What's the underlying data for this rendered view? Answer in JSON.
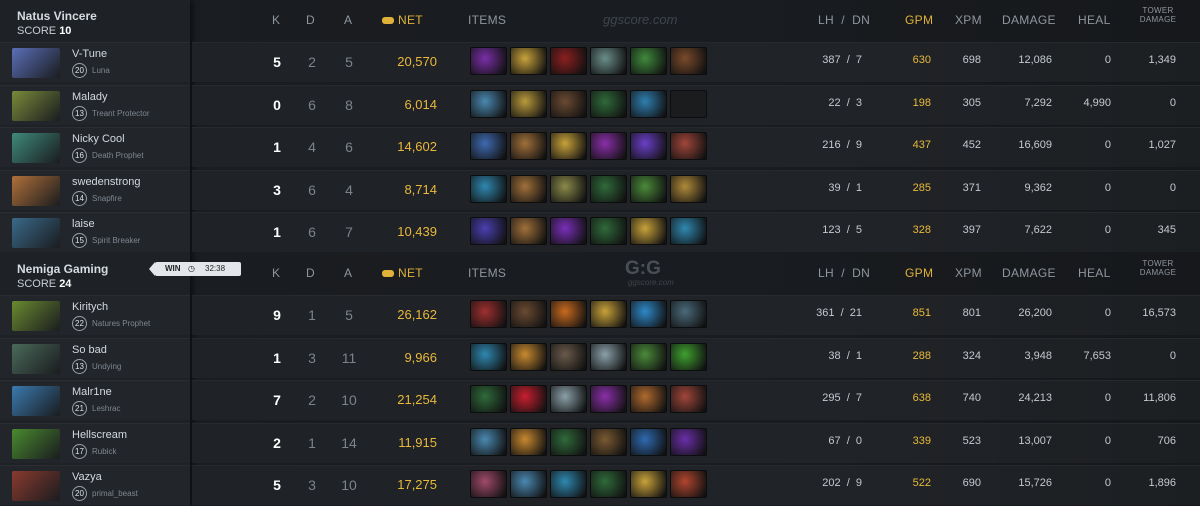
{
  "headers": {
    "k": "K",
    "d": "D",
    "a": "A",
    "net": "NET",
    "items": "ITEMS",
    "lhdn": "LH  /  DN",
    "gpm": "GPM",
    "xpm": "XPM",
    "damage": "DAMAGE",
    "heal": "HEAL",
    "tower": "TOWER DAMAGE"
  },
  "watermark": {
    "top": "ggscore.com",
    "logo": "G:G",
    "logo_sub": "ggscore.com"
  },
  "teams": [
    {
      "name": "Natus Vincere",
      "score_label": "SCORE",
      "score": "10",
      "players": [
        {
          "name": "V-Tune",
          "level": "20",
          "hero": "Luna",
          "k": "5",
          "d": "2",
          "a": "5",
          "net": "20,570",
          "lhdn": "387  /  7",
          "gpm": "630",
          "xpm": "698",
          "damage": "12,086",
          "heal": "0",
          "tower": "1,349",
          "portrait_color": "#5b6fb8",
          "items": [
            "#7a2fa8",
            "#c8a23a",
            "#8b1f1f",
            "#6a8e8a",
            "#3f8a3c",
            "#7a4a2a"
          ]
        },
        {
          "name": "Malady",
          "level": "13",
          "hero": "Treant Protector",
          "k": "0",
          "d": "6",
          "a": "8",
          "net": "6,014",
          "lhdn": "22  /  3",
          "gpm": "198",
          "xpm": "305",
          "damage": "7,292",
          "heal": "4,990",
          "tower": "0",
          "portrait_color": "#7a8a3a",
          "items": [
            "#4a88b0",
            "#b99a3c",
            "#6a4a32",
            "#2f6a3a",
            "#2f7fb0",
            "#1a1c1e"
          ]
        },
        {
          "name": "Nicky Cool",
          "level": "16",
          "hero": "Death Prophet",
          "k": "1",
          "d": "4",
          "a": "6",
          "net": "14,602",
          "lhdn": "216  /  9",
          "gpm": "437",
          "xpm": "452",
          "damage": "16,609",
          "heal": "0",
          "tower": "1,027",
          "portrait_color": "#3f8a7a",
          "items": [
            "#3f6ab0",
            "#a0703a",
            "#c8a23a",
            "#8a2fa8",
            "#6a3fc8",
            "#a0463a"
          ]
        },
        {
          "name": "swedenstrong",
          "level": "14",
          "hero": "Snapfire",
          "k": "3",
          "d": "6",
          "a": "4",
          "net": "8,714",
          "lhdn": "39  /  1",
          "gpm": "285",
          "xpm": "371",
          "damage": "9,362",
          "heal": "0",
          "tower": "0",
          "portrait_color": "#b0703a",
          "items": [
            "#2f88b0",
            "#a0703a",
            "#8a8a4a",
            "#2f6a3a",
            "#4a8a3a",
            "#b08a3a"
          ]
        },
        {
          "name": "laise",
          "level": "15",
          "hero": "Spirit Breaker",
          "k": "1",
          "d": "6",
          "a": "7",
          "net": "10,439",
          "lhdn": "123  /  5",
          "gpm": "328",
          "xpm": "397",
          "damage": "7,622",
          "heal": "0",
          "tower": "345",
          "portrait_color": "#3a6a8a",
          "items": [
            "#4a3fb0",
            "#a0703a",
            "#7a2fb8",
            "#2f6a3a",
            "#c8a23a",
            "#2f88b0"
          ]
        }
      ]
    },
    {
      "name": "Nemiga Gaming",
      "score_label": "SCORE",
      "score": "24",
      "result": "WIN",
      "duration": "32:38",
      "players": [
        {
          "name": "Kiritych",
          "level": "22",
          "hero": "Natures Prophet",
          "k": "9",
          "d": "1",
          "a": "5",
          "net": "26,162",
          "lhdn": "361  /  21",
          "gpm": "851",
          "xpm": "801",
          "damage": "26,200",
          "heal": "0",
          "tower": "16,573",
          "portrait_color": "#6a8a2f",
          "items": [
            "#a02f2f",
            "#6a4a32",
            "#c86a1f",
            "#c8a23a",
            "#2f88c8",
            "#4a6a7a"
          ]
        },
        {
          "name": "So bad",
          "level": "13",
          "hero": "Undying",
          "k": "1",
          "d": "3",
          "a": "11",
          "net": "9,966",
          "lhdn": "38  /  1",
          "gpm": "288",
          "xpm": "324",
          "damage": "3,948",
          "heal": "7,653",
          "tower": "0",
          "portrait_color": "#4a6a5a",
          "items": [
            "#2f88b0",
            "#c88a2f",
            "#6a5a4a",
            "#8aa0a8",
            "#4a8a3a",
            "#3fa02f"
          ]
        },
        {
          "name": "Malr1ne",
          "level": "21",
          "hero": "Leshrac",
          "k": "7",
          "d": "2",
          "a": "10",
          "net": "21,254",
          "lhdn": "295  /  7",
          "gpm": "638",
          "xpm": "740",
          "damage": "24,213",
          "heal": "0",
          "tower": "11,806",
          "portrait_color": "#3a7ab0",
          "items": [
            "#2f6a3a",
            "#c81f2f",
            "#8aa0a8",
            "#8a2fa8",
            "#b06a2f",
            "#a0463a"
          ]
        },
        {
          "name": "Hellscream",
          "level": "17",
          "hero": "Rubick",
          "k": "2",
          "d": "1",
          "a": "14",
          "net": "11,915",
          "lhdn": "67  /  0",
          "gpm": "339",
          "xpm": "523",
          "damage": "13,007",
          "heal": "0",
          "tower": "706",
          "portrait_color": "#4a8a2f",
          "items": [
            "#4a88b0",
            "#c8882f",
            "#2f6a3a",
            "#7a5a32",
            "#2f6ab0",
            "#6a2fa8"
          ]
        },
        {
          "name": "Vazya",
          "level": "20",
          "hero": "primal_beast",
          "k": "5",
          "d": "3",
          "a": "10",
          "net": "17,275",
          "lhdn": "202  /  9",
          "gpm": "522",
          "xpm": "690",
          "damage": "15,726",
          "heal": "0",
          "tower": "1,896",
          "portrait_color": "#8a3a2f",
          "items": [
            "#a04a6a",
            "#4a88b0",
            "#2f88b0",
            "#2f6a3a",
            "#c8a23a",
            "#b0462f"
          ]
        }
      ]
    }
  ]
}
